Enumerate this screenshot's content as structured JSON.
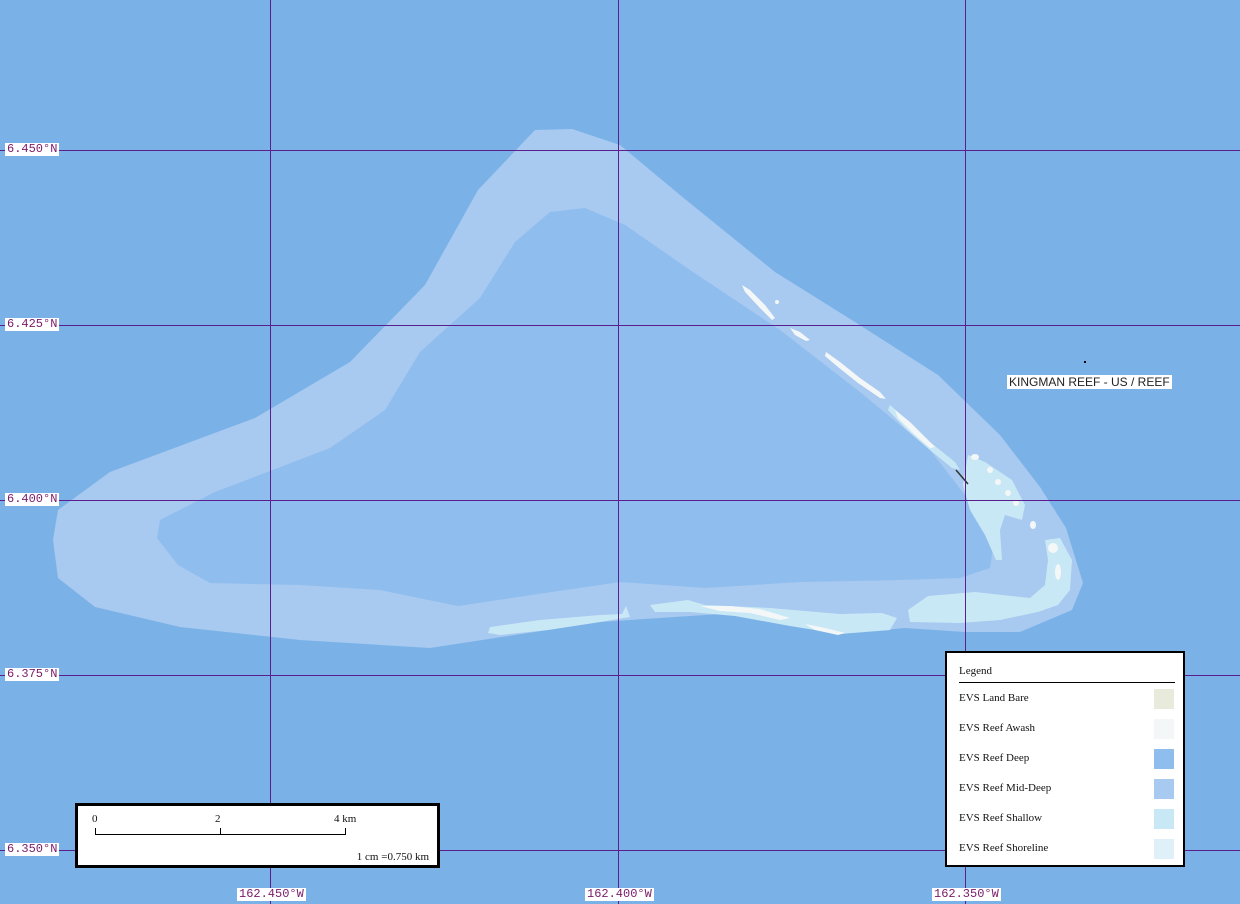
{
  "map": {
    "place_label": "KINGMAN REEF - US / REEF",
    "latitude_labels": [
      "6.450°N",
      "6.425°N",
      "6.400°N",
      "6.375°N",
      "6.350°N"
    ],
    "longitude_labels": [
      "162.450°W",
      "162.400°W",
      "162.350°W"
    ],
    "colors": {
      "ocean": "#7ab2e8",
      "grid": "#5a1f8c",
      "reef_mid_deep": "#a8c9f0",
      "reef_deep": "#8fbdee",
      "reef_shallow": "#c9e8f5",
      "reef_awash": "#f4f7f8"
    }
  },
  "legend": {
    "title": "Legend",
    "items": [
      {
        "label": "EVS Land Bare",
        "color": "#e8eadc"
      },
      {
        "label": "EVS Reef Awash",
        "color": "#f4f7f8"
      },
      {
        "label": "EVS Reef Deep",
        "color": "#8fbdee"
      },
      {
        "label": "EVS Reef Mid-Deep",
        "color": "#a8c9f0"
      },
      {
        "label": "EVS Reef Shallow",
        "color": "#c9e8f5"
      },
      {
        "label": "EVS Reef Shoreline",
        "color": "#dff0f8"
      }
    ]
  },
  "scale_bar": {
    "ticks": [
      "0",
      "2",
      "4 km"
    ],
    "ratio": "1 cm =0.750 km"
  }
}
